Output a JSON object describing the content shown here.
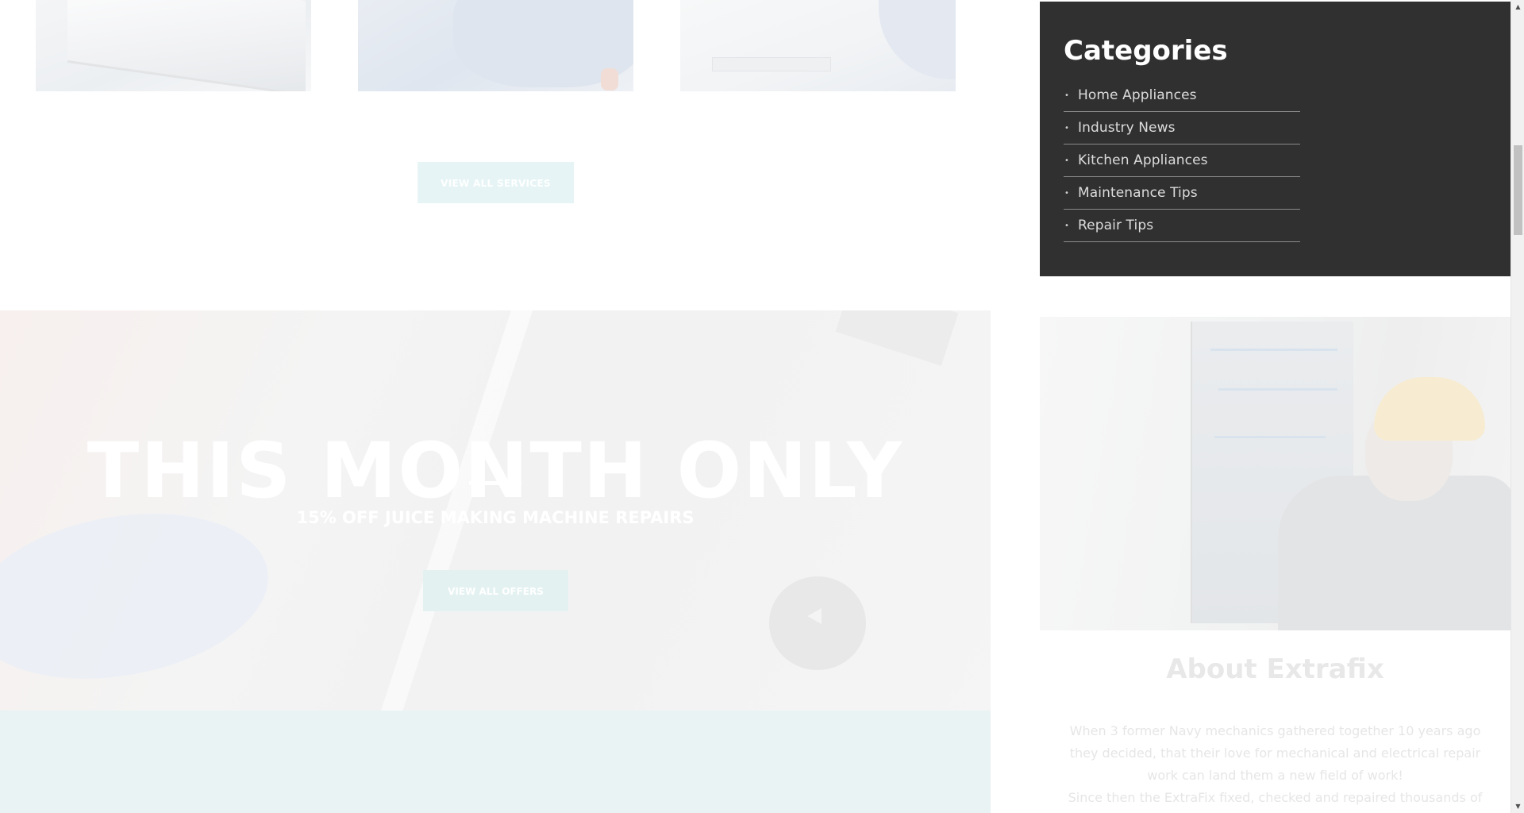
{
  "services": {
    "view_all_label": "VIEW ALL SERVICES"
  },
  "promo": {
    "title": "THIS MONTH ONLY",
    "subtitle": "15% OFF JUICE MAKING MACHINE REPAIRS",
    "button_label": "VIEW ALL OFFERS"
  },
  "sidebar": {
    "categories": {
      "title": "Categories",
      "bullet": "•",
      "items": [
        {
          "label": "Home Appliances"
        },
        {
          "label": "Industry News"
        },
        {
          "label": "Kitchen Appliances"
        },
        {
          "label": "Maintenance Tips"
        },
        {
          "label": "Repair Tips"
        }
      ]
    },
    "about": {
      "title": "About Extrafix",
      "text_line_1": "When 3 former Navy mechanics gathered together 10 years ago they decided, that their love for mechanical and electrical repair work can land them a new field of work!",
      "text_line_2": "Since then the ExtraFix fixed, checked and repaired thousands of"
    }
  },
  "scrollbar": {
    "up_icon": "▲",
    "down_icon": "▼"
  },
  "colors": {
    "sidebar_bg": "#303030",
    "button_bg": "#e6f4f5",
    "band_bg": "#e9f3f4"
  }
}
